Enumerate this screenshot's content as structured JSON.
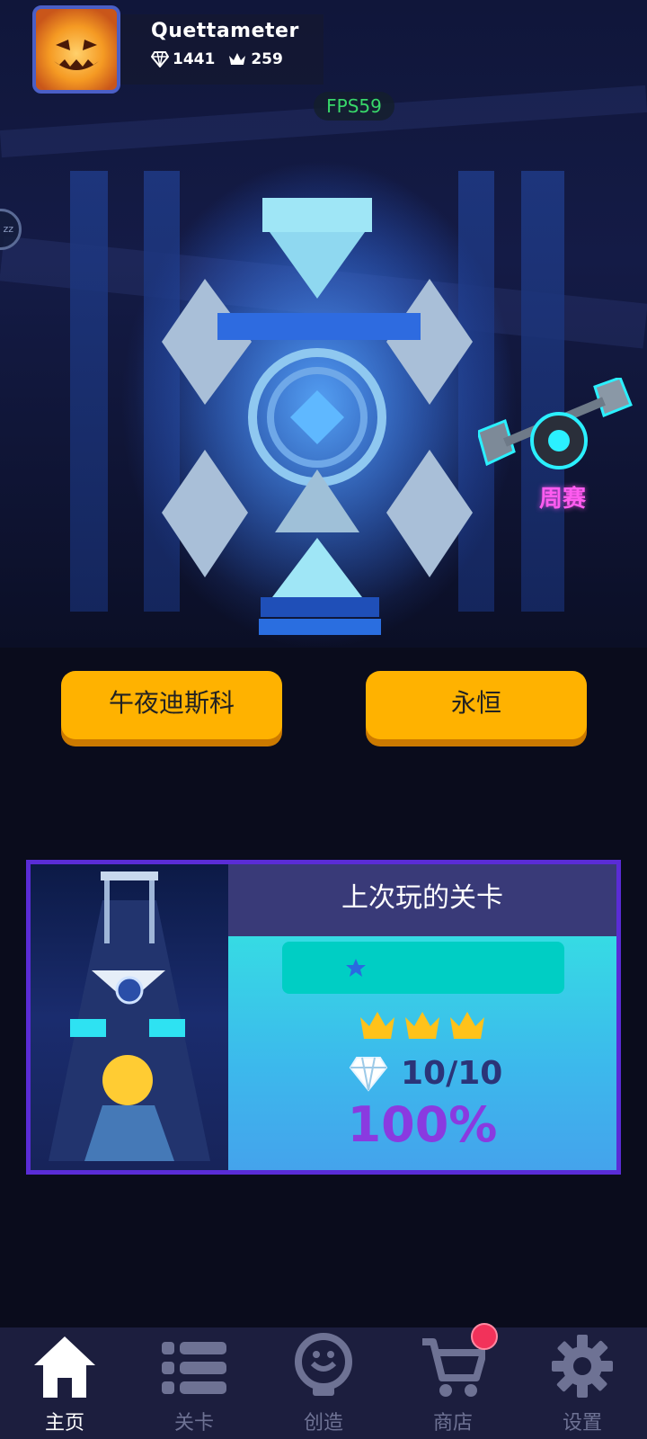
{
  "profile": {
    "username": "Quettameter",
    "gems": "1441",
    "crowns": "259"
  },
  "fps": "FPS59",
  "side_tab": "zz",
  "weekly": {
    "label": "周赛"
  },
  "songs": [
    {
      "label": "午夜迪斯科"
    },
    {
      "label": "永恒"
    }
  ],
  "last_played": {
    "title": "上次玩的关卡",
    "crowns_earned": 3,
    "gems": "10/10",
    "percent": "100%"
  },
  "nav": {
    "items": [
      {
        "label": "主页",
        "icon": "home-icon",
        "active": true
      },
      {
        "label": "关卡",
        "icon": "list-icon",
        "active": false
      },
      {
        "label": "创造",
        "icon": "lightbulb-icon",
        "active": false
      },
      {
        "label": "商店",
        "icon": "cart-icon",
        "active": false
      },
      {
        "label": "设置",
        "icon": "gear-icon",
        "active": false
      }
    ]
  },
  "colors": {
    "accent_button": "#ffb200",
    "card_border": "#5a2cd6",
    "fps_text": "#38d86a",
    "weekly_text": "#ff5cf0",
    "percent_text": "#8a3ae0"
  }
}
